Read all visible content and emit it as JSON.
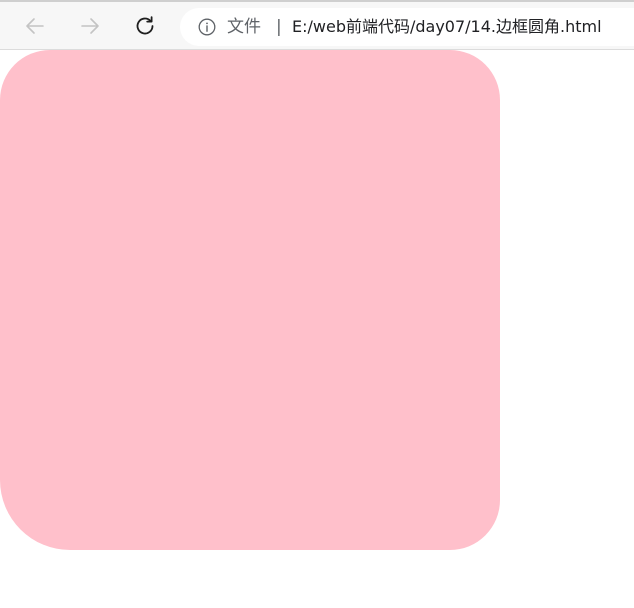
{
  "browser": {
    "address_bar": {
      "scheme_label": "文件",
      "separator": "|",
      "url": "E:/web前端代码/day07/14.边框圆角.html"
    },
    "icons": {
      "back": "arrow-left-icon",
      "forward": "arrow-right-icon",
      "reload": "reload-icon",
      "info": "info-icon"
    }
  },
  "page": {
    "box_color": "#ffc0cb"
  }
}
